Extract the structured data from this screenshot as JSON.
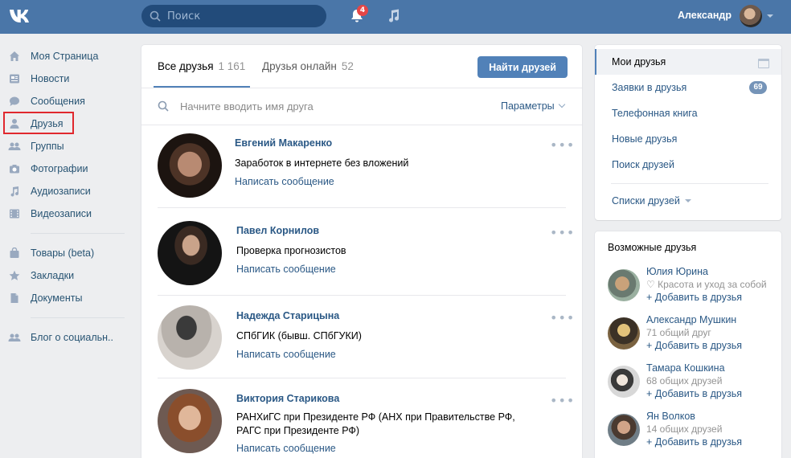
{
  "header": {
    "search_placeholder": "Поиск",
    "notifications_count": "4",
    "user_name": "Александр"
  },
  "nav": {
    "items": [
      {
        "label": "Моя Страница",
        "icon": "home-icon"
      },
      {
        "label": "Новости",
        "icon": "news-icon"
      },
      {
        "label": "Сообщения",
        "icon": "messages-icon"
      },
      {
        "label": "Друзья",
        "icon": "friends-icon"
      },
      {
        "label": "Группы",
        "icon": "groups-icon"
      },
      {
        "label": "Фотографии",
        "icon": "camera-icon"
      },
      {
        "label": "Аудиозаписи",
        "icon": "music-icon"
      },
      {
        "label": "Видеозаписи",
        "icon": "video-icon"
      },
      {
        "label": "Товары (beta)",
        "icon": "bag-icon"
      },
      {
        "label": "Закладки",
        "icon": "star-icon"
      },
      {
        "label": "Документы",
        "icon": "document-icon"
      },
      {
        "label": "Блог о социальн..",
        "icon": "group-icon"
      }
    ]
  },
  "tabs": {
    "all_label": "Все друзья",
    "all_count": "1 161",
    "online_label": "Друзья онлайн",
    "online_count": "52",
    "find_button": "Найти друзей"
  },
  "filter": {
    "placeholder": "Начните вводить имя друга",
    "params_label": "Параметры"
  },
  "friends": [
    {
      "name": "Евгений Макаренко",
      "sub": "Заработок в интернете без вложений",
      "action": "Написать сообщение"
    },
    {
      "name": "Павел Корнилов",
      "sub": "Проверка прогнозистов",
      "action": "Написать сообщение"
    },
    {
      "name": "Надежда Старицына",
      "sub": "СПбГИК (бывш. СПбГУКИ)",
      "action": "Написать сообщение"
    },
    {
      "name": "Виктория Старикова",
      "sub": "РАНХиГС при Президенте РФ (АНХ при Правительстве РФ, РАГС при Президенте РФ)",
      "action": "Написать сообщение"
    }
  ],
  "right_menu": {
    "items": [
      "Мои друзья",
      "Заявки в друзья",
      "Телефонная книга",
      "Новые друзья",
      "Поиск друзей"
    ],
    "requests_count": "69",
    "lists_label": "Списки друзей"
  },
  "possible": {
    "title": "Возможные друзья",
    "add_label": "+ Добавить в друзья",
    "people": [
      {
        "name": "Юлия Юрина",
        "desc": "♡ Красота и уход за собой"
      },
      {
        "name": "Александр Мушкин",
        "desc": "71 общий друг"
      },
      {
        "name": "Тамара Кошкина",
        "desc": "68 общих друзей"
      },
      {
        "name": "Ян Волков",
        "desc": "14 общих друзей"
      }
    ]
  },
  "colors": {
    "header_bg": "#4a76a8",
    "link": "#2a5885",
    "accent": "#5181b8",
    "highlight": "#e0282e"
  }
}
